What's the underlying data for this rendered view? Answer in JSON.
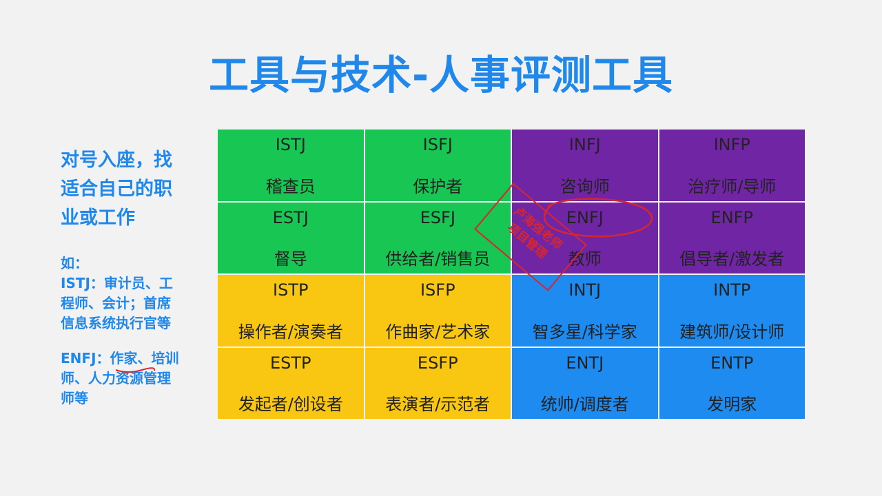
{
  "title": "工具与技术-人事评测工具",
  "left": {
    "headline_lines": [
      "对号入座，找",
      "适合自己的职",
      "业或工作"
    ],
    "examples": [
      {
        "lines": [
          "如：",
          "ISTJ：审计员、工",
          "程师、会计；首席",
          "信息系统执行官等"
        ]
      },
      {
        "lines": [
          "ENFJ：作家、培训",
          "师、人力资源管理",
          "师等"
        ]
      }
    ]
  },
  "grid": {
    "cells": [
      {
        "code": "ISTJ",
        "role": "稽查员",
        "color": "#17c653"
      },
      {
        "code": "ISFJ",
        "role": "保护者",
        "color": "#17c653"
      },
      {
        "code": "INFJ",
        "role": "咨询师",
        "color": "#7025a4"
      },
      {
        "code": "INFP",
        "role": "治疗师/导师",
        "color": "#7025a4"
      },
      {
        "code": "ESTJ",
        "role": "督导",
        "color": "#17c653"
      },
      {
        "code": "ESFJ",
        "role": "供给者/销售员",
        "color": "#17c653"
      },
      {
        "code": "ENFJ",
        "role": "教师",
        "color": "#7025a4"
      },
      {
        "code": "ENFP",
        "role": "倡导者/激发者",
        "color": "#7025a4"
      },
      {
        "code": "ISTP",
        "role": "操作者/演奏者",
        "color": "#f9c712"
      },
      {
        "code": "ISFP",
        "role": "作曲家/艺术家",
        "color": "#f9c712"
      },
      {
        "code": "INTJ",
        "role": "智多星/科学家",
        "color": "#1e8bf1"
      },
      {
        "code": "INTP",
        "role": "建筑师/设计师",
        "color": "#1e8bf1"
      },
      {
        "code": "ESTP",
        "role": "发起者/创设者",
        "color": "#f9c712"
      },
      {
        "code": "ESFP",
        "role": "表演者/示范者",
        "color": "#f9c712"
      },
      {
        "code": "ENTJ",
        "role": "统帅/调度者",
        "color": "#1e8bf1"
      },
      {
        "code": "ENTP",
        "role": "发明家",
        "color": "#1e8bf1"
      }
    ]
  },
  "stamp": {
    "lines": [
      "卢海强老师",
      "项目管理"
    ],
    "color": "#d7262e"
  },
  "colors": {
    "accent": "#1f88ea",
    "annotation": "#d7262e"
  }
}
